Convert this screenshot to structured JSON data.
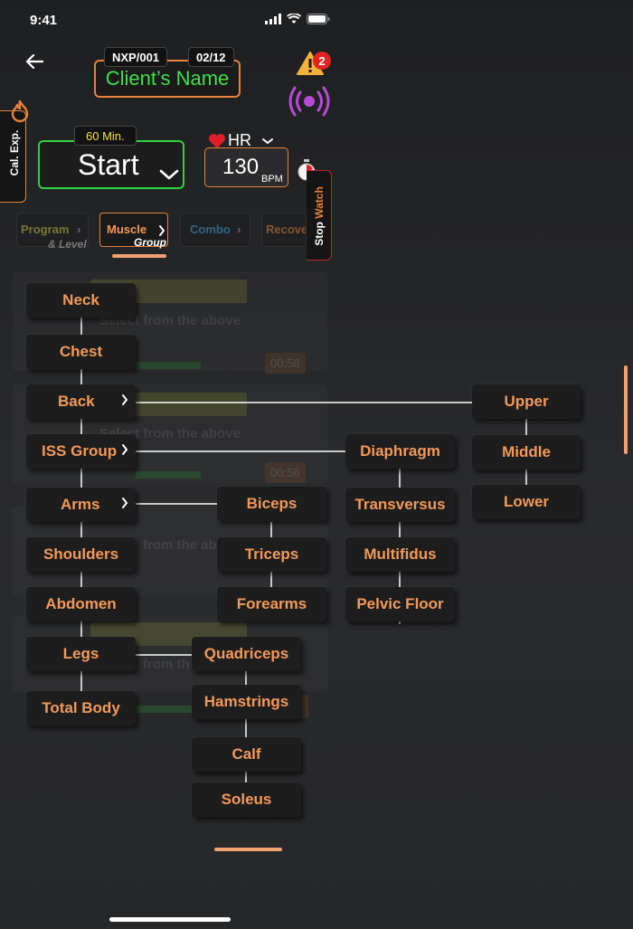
{
  "status": {
    "time": "9:41"
  },
  "header": {
    "client_id": "NXP/001",
    "session": "02/12",
    "client_name": "Client’s Name",
    "alert_count": "2"
  },
  "side_tabs": {
    "cal_exp": "Cal. Exp.",
    "stop_watch_1": "Stop",
    "stop_watch_2": "Watch"
  },
  "session_control": {
    "duration": "60 Min.",
    "start_label": "Start"
  },
  "heart_rate": {
    "label": "HR",
    "value": "130",
    "unit": "BPM"
  },
  "mode_tabs": [
    {
      "label": "Program",
      "sub": "& Level"
    },
    {
      "label": "Muscle",
      "sub": "Group"
    },
    {
      "label": "Combo",
      "sub": ""
    },
    {
      "label": "Recove",
      "sub": ""
    }
  ],
  "background": {
    "hint_1": "Select from the above",
    "hint_2": "Select from the above",
    "hint_3": "from the abo",
    "hint_4": "from th",
    "time_1": "00:56",
    "time_2": "00:56"
  },
  "muscle_tree": {
    "level1": [
      "Neck",
      "Chest",
      "Back",
      "ISS Group",
      "Arms",
      "Shoulders",
      "Abdomen",
      "Legs",
      "Total Body"
    ],
    "arms": [
      "Biceps",
      "Triceps",
      "Forearms"
    ],
    "legs": [
      "Quadriceps",
      "Hamstrings",
      "Calf",
      "Soleus"
    ],
    "iss": [
      "Diaphragm",
      "Transversus",
      "Multifidus",
      "Pelvic Floor"
    ],
    "back": [
      "Upper",
      "Middle",
      "Lower"
    ]
  },
  "colors": {
    "accent": "#e8823a",
    "label": "#f2995a",
    "green": "#2ed43a",
    "alert_red": "#e02424",
    "purple": "#b84ad8"
  }
}
